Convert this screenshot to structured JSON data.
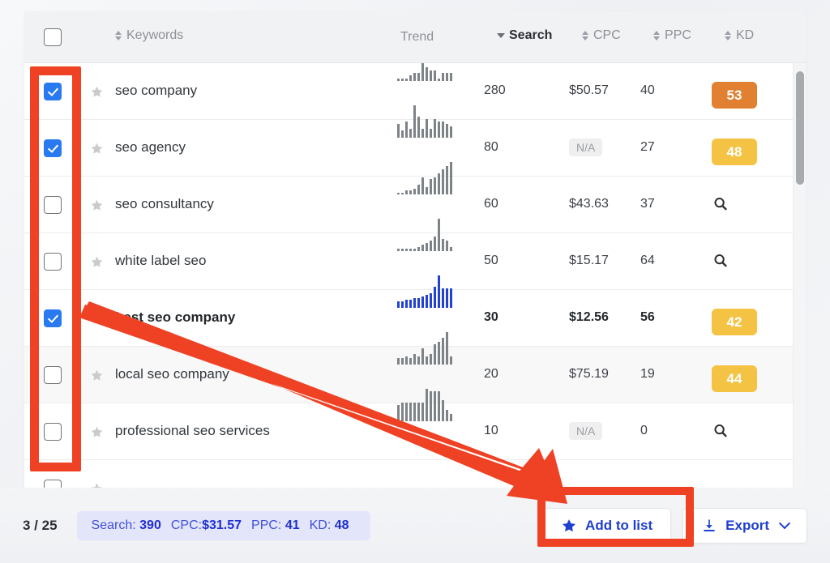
{
  "colors": {
    "accent_blue": "#2979f0",
    "link_blue": "#1f3fd0",
    "annotation_red": "#ef4123",
    "kd_orange": "#e08030",
    "kd_yellow": "#f5c344",
    "summary_pill_bg": "#e3e5fb",
    "spark_gray": "#7e8388",
    "spark_blue": "#2342d0"
  },
  "table": {
    "select_all_checked": false,
    "columns": [
      {
        "key": "check",
        "label": "",
        "sortable": false,
        "sorted": false
      },
      {
        "key": "keyword",
        "label": "Keywords",
        "sortable": true,
        "sorted": false
      },
      {
        "key": "trend",
        "label": "Trend",
        "sortable": false,
        "sorted": false
      },
      {
        "key": "search",
        "label": "Search",
        "sortable": true,
        "sorted": true
      },
      {
        "key": "cpc",
        "label": "CPC",
        "sortable": true,
        "sorted": false
      },
      {
        "key": "ppc",
        "label": "PPC",
        "sortable": true,
        "sorted": false
      },
      {
        "key": "kd",
        "label": "KD",
        "sortable": true,
        "sorted": false
      }
    ],
    "sort_direction": "desc",
    "rows": [
      {
        "checked": true,
        "starred": false,
        "highlight": false,
        "alt": false,
        "keyword": "seo company",
        "search": "280",
        "cpc": "$50.57",
        "cpc_na": false,
        "ppc": "40",
        "kd": "53",
        "kd_type": "badge",
        "kd_color": "#e08030",
        "trend": [
          1,
          1,
          1,
          2,
          3,
          3,
          12,
          5,
          4,
          4,
          1,
          3,
          3,
          3
        ]
      },
      {
        "checked": true,
        "starred": false,
        "highlight": false,
        "alt": false,
        "keyword": "seo agency",
        "search": "80",
        "cpc": "N/A",
        "cpc_na": true,
        "ppc": "27",
        "kd": "48",
        "kd_type": "badge",
        "kd_color": "#f5c344",
        "trend": [
          6,
          3,
          7,
          4,
          14,
          9,
          4,
          8,
          4,
          8,
          7,
          7,
          6,
          5
        ]
      },
      {
        "checked": false,
        "starred": false,
        "highlight": false,
        "alt": false,
        "keyword": "seo consultancy",
        "search": "60",
        "cpc": "$43.63",
        "cpc_na": false,
        "ppc": "37",
        "kd": "",
        "kd_type": "search",
        "kd_color": "",
        "trend": [
          1,
          1,
          2,
          2,
          3,
          5,
          9,
          4,
          8,
          9,
          11,
          13,
          15,
          17
        ]
      },
      {
        "checked": false,
        "starred": false,
        "highlight": false,
        "alt": false,
        "keyword": "white label seo",
        "search": "50",
        "cpc": "$15.17",
        "cpc_na": false,
        "ppc": "64",
        "kd": "",
        "kd_type": "search",
        "kd_color": "",
        "trend": [
          1,
          1,
          1,
          1,
          1,
          2,
          3,
          4,
          5,
          7,
          16,
          6,
          5,
          2
        ]
      },
      {
        "checked": true,
        "starred": false,
        "highlight": true,
        "alt": false,
        "keyword": "best seo company",
        "search": "30",
        "cpc": "$12.56",
        "cpc_na": false,
        "ppc": "56",
        "kd": "42",
        "kd_type": "badge",
        "kd_color": "#f5c344",
        "trend": [
          4,
          4,
          5,
          5,
          6,
          6,
          7,
          8,
          9,
          13,
          20,
          12,
          12,
          12
        ]
      },
      {
        "checked": false,
        "starred": false,
        "highlight": false,
        "alt": true,
        "keyword": "local seo company",
        "search": "20",
        "cpc": "$75.19",
        "cpc_na": false,
        "ppc": "19",
        "kd": "44",
        "kd_type": "badge",
        "kd_color": "#f5c344",
        "trend": [
          3,
          3,
          4,
          3,
          5,
          4,
          8,
          4,
          5,
          10,
          11,
          13,
          16,
          4
        ]
      },
      {
        "checked": false,
        "starred": false,
        "highlight": false,
        "alt": false,
        "keyword": "professional seo services",
        "search": "10",
        "cpc": "N/A",
        "cpc_na": true,
        "ppc": "0",
        "kd": "",
        "kd_type": "search",
        "kd_color": "",
        "trend": [
          7,
          8,
          8,
          8,
          8,
          8,
          8,
          14,
          13,
          13,
          13,
          9,
          5,
          3
        ]
      }
    ]
  },
  "footer": {
    "count": "3 / 25",
    "summary": {
      "search_label": "Search:",
      "search_value": "390",
      "cpc_label": "CPC:",
      "cpc_value": "$31.57",
      "ppc_label": "PPC:",
      "ppc_value": "41",
      "kd_label": "KD:",
      "kd_value": "48"
    },
    "add_to_list_label": "Add to list",
    "export_label": "Export"
  }
}
